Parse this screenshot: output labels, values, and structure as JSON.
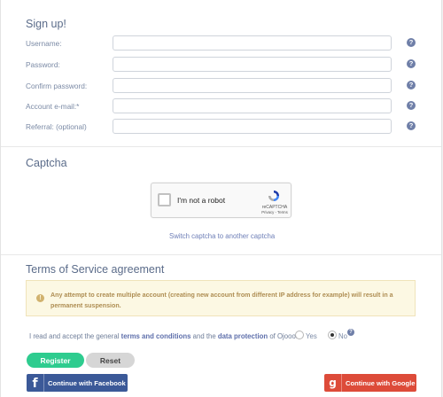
{
  "signup": {
    "title": "Sign up!",
    "fields": [
      {
        "label": "Username:",
        "value": ""
      },
      {
        "label": "Password:",
        "value": ""
      },
      {
        "label": "Confirm password:",
        "value": ""
      },
      {
        "label": "Account e-mail:*",
        "value": ""
      },
      {
        "label": "Referral: (optional)",
        "value": ""
      }
    ],
    "help_glyph": "?"
  },
  "captcha": {
    "title": "Captcha",
    "checkbox_label": "I'm not a robot",
    "brand": "reCAPTCHA",
    "terms": "Privacy - Terms",
    "switch_link": "Switch captcha to another captcha"
  },
  "tos": {
    "title": "Terms of Service agreement",
    "warning_icon": "!",
    "warning": "Any attempt to create multiple account (creating new account from different IP address for example) will result in a permanent suspension.",
    "accept_prefix": "I read and accept the general",
    "terms_link": "terms and conditions",
    "middle": "and the",
    "privacy_link": "data protection",
    "suffix": "of Ojooo.",
    "yes_label": "Yes",
    "no_label": "No",
    "selected": "No"
  },
  "actions": {
    "register": "Register",
    "reset": "Reset",
    "facebook_icon": "f",
    "facebook": "Continue with Facebook",
    "google_icon": "g",
    "google": "Continue with Google"
  },
  "colors": {
    "register_green": "#2ecc8f",
    "facebook_blue": "#3b5998",
    "google_red": "#dd4b39",
    "warning_bg": "#fcf8e3",
    "link_blue": "#6e7fb7"
  }
}
